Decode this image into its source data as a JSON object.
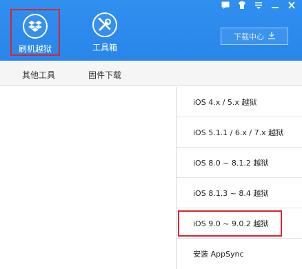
{
  "window": {
    "controls": [
      "▬",
      "▮",
      "▽",
      "—",
      "✕"
    ]
  },
  "nav": {
    "flash": {
      "label": "刷机越狱",
      "icon": "dropbox-box-icon"
    },
    "tools": {
      "label": "工具箱",
      "icon": "wrench-screwdriver-icon"
    }
  },
  "download": {
    "label": "下载中心",
    "icon": "download-icon"
  },
  "subtabs": {
    "other": "其他工具",
    "firmware": "固件下载"
  },
  "menu": {
    "items": [
      "iOS 4.x / 5.x 越狱",
      "iOS 5.1.1 / 6.x / 7.x 越狱",
      "iOS 8.0 ~ 8.1.2 越狱",
      "iOS 8.1.3 ~ 8.4 越狱",
      "iOS 9.0 ~ 9.0.2 越狱",
      "安装 AppSync"
    ],
    "highlighted_index": 4
  },
  "colors": {
    "brand_blue": "#2a86ea",
    "highlight_red": "#d9252b"
  }
}
